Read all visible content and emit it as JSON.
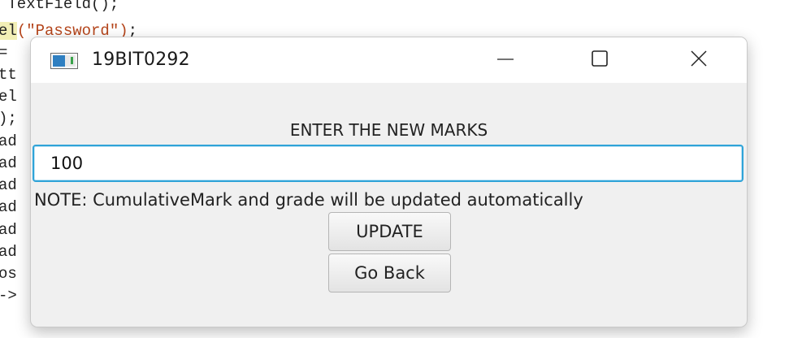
{
  "code_lines": [
    {
      "pre": " TextField();",
      "str": "",
      "post": ""
    },
    {
      "pre": "el",
      "str": "(\"Password\")",
      "post": ";"
    },
    {
      "pre": "=",
      "str": "",
      "post": ""
    },
    {
      "pre": "tt",
      "str": "",
      "post": ""
    },
    {
      "pre": "el",
      "str": "",
      "post": ""
    },
    {
      "pre": ");",
      "str": "",
      "post": ""
    },
    {
      "pre": "ad",
      "str": "",
      "post": ""
    },
    {
      "pre": "ad",
      "str": "",
      "post": ""
    },
    {
      "pre": "ad",
      "str": "",
      "post": ""
    },
    {
      "pre": "ad",
      "str": "",
      "post": ""
    },
    {
      "pre": "ad",
      "str": "",
      "post": ""
    },
    {
      "pre": "ad",
      "str": "",
      "post": ""
    },
    {
      "pre": "os",
      "str": "",
      "post": ""
    },
    {
      "pre": "->",
      "str": "",
      "post": ""
    }
  ],
  "window": {
    "title": "19BIT0292",
    "controls": {
      "minimize": "—",
      "maximize": "☐",
      "close": "✕"
    }
  },
  "form": {
    "heading": "ENTER THE NEW MARKS",
    "marks_value": "100",
    "note": "NOTE: CumulativeMark and grade will be updated automatically",
    "update_label": "UPDATE",
    "back_label": "Go Back"
  },
  "colors": {
    "accent_focus": "#2fa3d8",
    "string_literal": "#b5451b"
  }
}
